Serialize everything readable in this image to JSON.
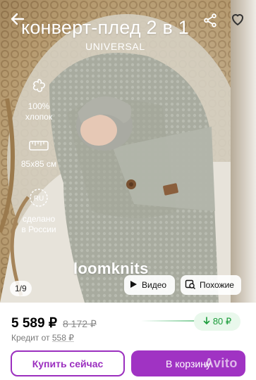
{
  "header": {
    "title": "конверт-плед 2 в 1",
    "subtitle": "UNIVERSAL"
  },
  "features": [
    {
      "label": "100%\nхлопок",
      "icon": "cotton-icon"
    },
    {
      "label": "85x85 см",
      "icon": "measuring-tape-icon"
    },
    {
      "label": "сделано\nв России",
      "icon": "ru-badge-icon",
      "badge_text": "RU"
    }
  ],
  "brand": "loomknits",
  "gallery": {
    "counter": "1/9",
    "video_label": "Видео",
    "similar_label": "Похожие"
  },
  "pricing": {
    "price": "5 589 ₽",
    "old_price": "8 172 ₽",
    "bonus": "80 ₽",
    "credit_prefix": "Кредит от",
    "credit_value": "558 ₽"
  },
  "actions": {
    "buy_now": "Купить сейчас",
    "add_to_cart": "В корзину"
  },
  "watermark": "Avito",
  "colors": {
    "accent": "#a033c3",
    "bonus_green": "#1a9c3a"
  }
}
